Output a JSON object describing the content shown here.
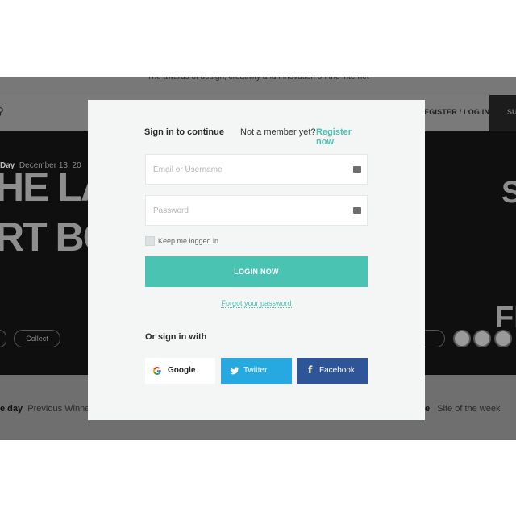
{
  "background": {
    "tagline": "The awards of design, creativity and innovation on the internet",
    "nav": {
      "register_login": "EGISTER / LOG IN",
      "submit": "SU"
    },
    "hero": {
      "day_label": "Day",
      "date": "December 13, 20",
      "headline_line1": "HE LA",
      "headline_line2": "RT BO",
      "collect_label": "Collect",
      "right_line1": "S",
      "right_line2": "FI"
    },
    "bottom": {
      "left_bold": "e day",
      "left_text": "Previous Winne",
      "right_bold": "ence",
      "right_text": "Site of the week"
    }
  },
  "modal": {
    "title": "Sign in to continue",
    "not_member": "Not a member yet?",
    "register_link": "Register now",
    "email_placeholder": "Email or Username",
    "password_placeholder": "Password",
    "keep_logged": "Keep me logged in",
    "login_button": "LOGIN NOW",
    "forgot": "Forgot your password",
    "or_sign_in": "Or sign in with",
    "social": {
      "google": "Google",
      "twitter": "Twitter",
      "facebook": "Facebook"
    }
  },
  "colors": {
    "accent": "#4ac3b3",
    "twitter": "#26a9e1",
    "facebook": "#2e5597",
    "modal_bg": "#f4f5f5"
  },
  "icons": {
    "email_field": "keyboard-icon",
    "password_field": "keyboard-icon",
    "google": "google-icon",
    "twitter": "twitter-bird-icon",
    "facebook": "facebook-f-icon"
  }
}
